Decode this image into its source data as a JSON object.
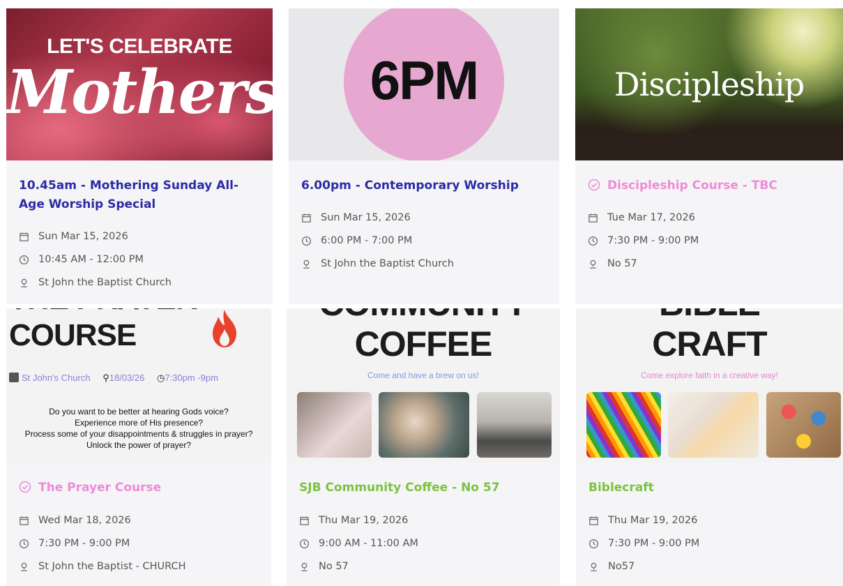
{
  "colors": {
    "title_blue": "#2b2ba6",
    "title_pink": "#f08ad8",
    "title_green": "#7cc242",
    "meta_gray": "#555555"
  },
  "events": [
    {
      "image": {
        "line1": "LET'S CELEBRATE",
        "line2": "Mothers"
      },
      "title": "10.45am - Mothering Sunday All-Age Worship Special",
      "date": "Sun Mar 15, 2026",
      "time": "10:45 AM - 12:00 PM",
      "location": "St John the Baptist Church"
    },
    {
      "image": {
        "text": "6PM"
      },
      "title": "6.00pm - Contemporary Worship",
      "date": "Sun Mar 15, 2026",
      "time": "6:00 PM - 7:00 PM",
      "location": "St John the Baptist Church"
    },
    {
      "image": {
        "text": "Discipleship"
      },
      "title": "Discipleship Course - TBC",
      "date": "Tue Mar 17, 2026",
      "time": "7:30 PM - 9:00 PM",
      "location": "No 57"
    },
    {
      "image": {
        "line1": "THE PRAYER",
        "line2": "COURSE",
        "venue": "St John's Church",
        "date": "18/03/26",
        "time": "7:30pm -9pm",
        "q1": "Do you want to be better at hearing Gods voice?",
        "q2": "Experience more of His presence?",
        "q3": "Process some of your disappointments & struggles in prayer?",
        "q4": "Unlock the power of prayer?"
      },
      "title": "The Prayer Course",
      "date": "Wed Mar 18, 2026",
      "time": "7:30 PM - 9:00 PM",
      "location": "St John the Baptist - CHURCH"
    },
    {
      "image": {
        "line1": "COMMUNITY",
        "line2": "COFFEE",
        "sub": "Come and have a brew on us!"
      },
      "title": "SJB Community Coffee - No 57",
      "date": "Thu Mar 19, 2026",
      "time": "9:00 AM - 11:00 AM",
      "location": "No 57"
    },
    {
      "image": {
        "line1": "BIBLE",
        "line2": "CRAFT",
        "sub": "Come explore faith in a creative way!"
      },
      "title": "Biblecraft",
      "date": "Thu Mar 19, 2026",
      "time": "7:30 PM - 9:00 PM",
      "location": "No57"
    }
  ]
}
